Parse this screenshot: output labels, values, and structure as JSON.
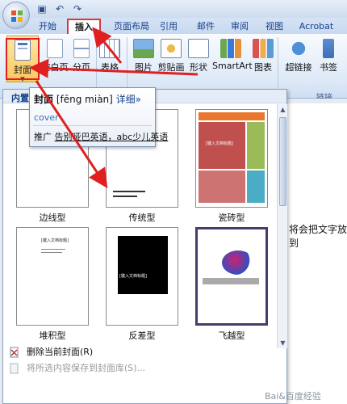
{
  "quick_access": {
    "undo_glyph": "↶",
    "redo_glyph": "↷",
    "save_glyph": "▣"
  },
  "tabs": [
    "开始",
    "插入",
    "页面布局",
    "引用",
    "邮件",
    "审阅",
    "视图",
    "Acrobat"
  ],
  "ribbon": {
    "cover_label": "封面",
    "blank_label": "空白页",
    "break_label": "分页",
    "table_label": "表格",
    "picture_label": "图片",
    "clipart_label": "剪贴画",
    "shapes_label": "形状",
    "smartart_label": "SmartArt",
    "chart_label": "图表",
    "hyperlink_label": "超链接",
    "bookmark_label": "书签",
    "group_links": "链接"
  },
  "gallery": {
    "header": "内置",
    "items": [
      {
        "label": "边线型"
      },
      {
        "label": "传统型"
      },
      {
        "label": "瓷砖型"
      },
      {
        "label": "堆积型"
      },
      {
        "label": "反差型"
      },
      {
        "label": "飞越型"
      }
    ],
    "thumb_text": "[键入文档标题]",
    "menu": {
      "remove": "删除当前封面(R)",
      "save": "将所选内容保存到封面库(S)..."
    }
  },
  "tooltip": {
    "word": "封面",
    "pinyin": "[fēng  miàn]",
    "more": "详细»",
    "translation": "cover",
    "promo_prefix": "推广",
    "promo_link": "告别哑巴英语，abc少儿英语"
  },
  "document": {
    "visible_text": "将会把文字放到"
  },
  "watermark": "Bai&百度经验",
  "colors": {
    "accent": "#d13c3c",
    "ribbon": "#dfeaf8",
    "selected": "#fbc85c"
  }
}
